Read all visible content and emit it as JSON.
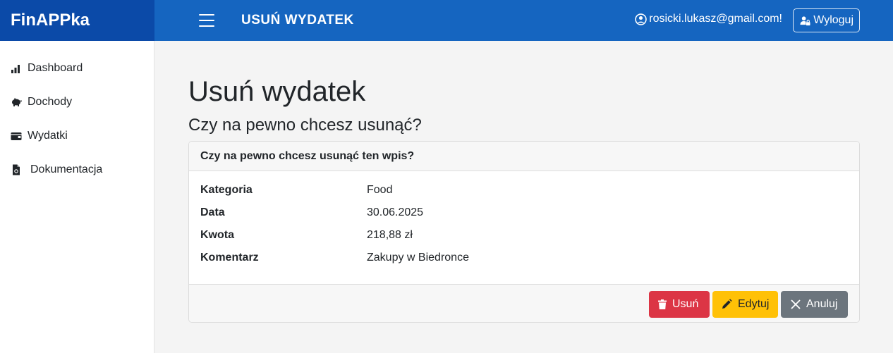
{
  "brand": "FinAPPka",
  "header": {
    "title": "USUŃ WYDATEK",
    "user_email": "rosicki.lukasz@gmail.com!",
    "logout_label": "Wyloguj"
  },
  "sidebar": {
    "items": [
      {
        "label": "Dashboard",
        "icon": "bar-chart-icon"
      },
      {
        "label": "Dochody",
        "icon": "piggy-bank-icon"
      },
      {
        "label": "Wydatki",
        "icon": "wallet-icon"
      },
      {
        "label": "Dokumentacja",
        "icon": "document-icon"
      }
    ]
  },
  "main": {
    "title": "Usuń wydatek",
    "subtitle": "Czy na pewno chcesz usunąć?",
    "card": {
      "header": "Czy na pewno chcesz usunąć ten wpis?",
      "fields": [
        {
          "label": "Kategoria",
          "value": "Food"
        },
        {
          "label": "Data",
          "value": "30.06.2025"
        },
        {
          "label": "Kwota",
          "value": "218,88 zł"
        },
        {
          "label": "Komentarz",
          "value": "Zakupy w Biedronce"
        }
      ],
      "buttons": {
        "delete": "Usuń",
        "edit": "Edytuj",
        "cancel": "Anuluj"
      }
    }
  },
  "colors": {
    "brand_bg": "#0b4aa8",
    "topbar_bg": "#1565c0",
    "danger": "#dc3545",
    "warning": "#ffc107",
    "secondary": "#6c757d"
  }
}
